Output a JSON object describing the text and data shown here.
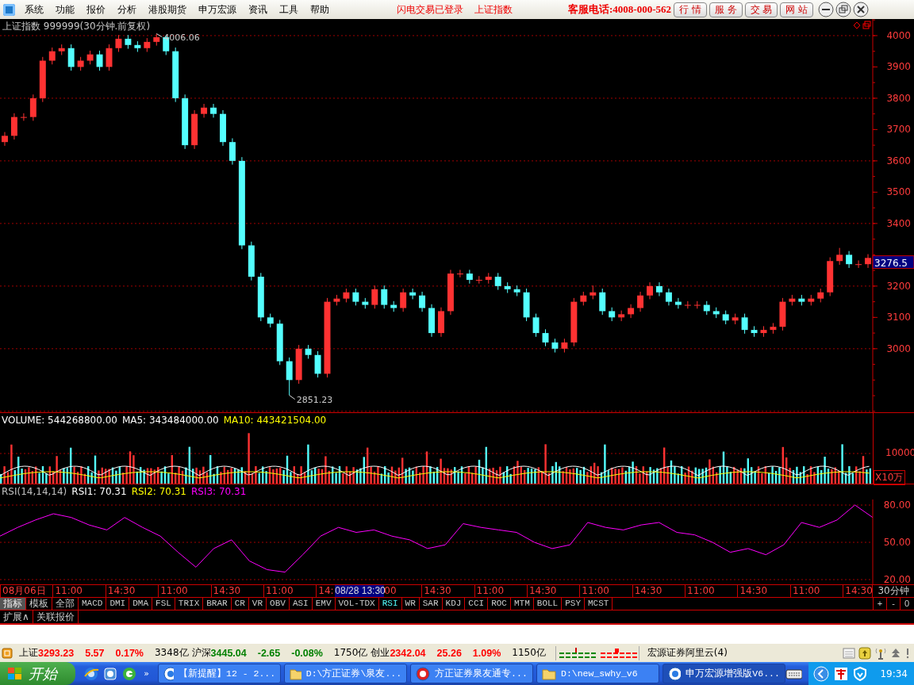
{
  "menu": {
    "items": [
      "系统",
      "功能",
      "报价",
      "分析",
      "港股期货",
      "申万宏源",
      "资讯",
      "工具",
      "帮助"
    ],
    "notices": [
      "闪电交易已登录",
      "上证指数"
    ],
    "hotline": "客服电话:4008-000-562",
    "buttons": [
      "行 情",
      "服 务",
      "交 易",
      "网 站"
    ]
  },
  "price_panel": {
    "chart_data": {
      "type": "candlestick",
      "title": "上证指数 999999(30分钟.前复权)",
      "ylim": [
        2797,
        4053
      ],
      "yticks": [
        3000,
        3100,
        3200,
        3400,
        3500,
        3600,
        3700,
        3800,
        3900,
        4000
      ],
      "grid": true,
      "ohlc": [
        [
          3660,
          3692,
          3648,
          3680
        ],
        [
          3680,
          3752,
          3668,
          3740
        ],
        [
          3740,
          3752,
          3728,
          3740
        ],
        [
          3740,
          3812,
          3728,
          3800
        ],
        [
          3800,
          3932,
          3788,
          3920
        ],
        [
          3920,
          3962,
          3908,
          3950
        ],
        [
          3950,
          3972,
          3938,
          3960
        ],
        [
          3960,
          3972,
          3888,
          3900
        ],
        [
          3900,
          3932,
          3888,
          3920
        ],
        [
          3920,
          3952,
          3908,
          3940
        ],
        [
          3940,
          3952,
          3888,
          3900
        ],
        [
          3900,
          3972,
          3888,
          3960
        ],
        [
          3960,
          4002,
          3948,
          3990
        ],
        [
          3990,
          4002,
          3958,
          3970
        ],
        [
          3970,
          3982,
          3948,
          3960
        ],
        [
          3960,
          3992,
          3948,
          3980
        ],
        [
          3980,
          4006.06,
          3968,
          3995
        ],
        [
          3995,
          4000,
          3938,
          3950
        ],
        [
          3950,
          3962,
          3788,
          3800
        ],
        [
          3800,
          3812,
          3638,
          3650
        ],
        [
          3650,
          3762,
          3638,
          3750
        ],
        [
          3750,
          3782,
          3738,
          3770
        ],
        [
          3770,
          3782,
          3738,
          3750
        ],
        [
          3750,
          3762,
          3648,
          3660
        ],
        [
          3660,
          3672,
          3588,
          3600
        ],
        [
          3600,
          3612,
          3318,
          3330
        ],
        [
          3330,
          3342,
          3218,
          3230
        ],
        [
          3230,
          3242,
          3088,
          3100
        ],
        [
          3100,
          3112,
          3068,
          3080
        ],
        [
          3080,
          3092,
          2948,
          2960
        ],
        [
          2960,
          2972,
          2851.23,
          2900
        ],
        [
          2900,
          3012,
          2888,
          3000
        ],
        [
          3000,
          3012,
          2968,
          2980
        ],
        [
          2980,
          2992,
          2908,
          2920
        ],
        [
          2920,
          3162,
          2908,
          3150
        ],
        [
          3150,
          3172,
          3138,
          3160
        ],
        [
          3160,
          3192,
          3148,
          3180
        ],
        [
          3180,
          3192,
          3138,
          3150
        ],
        [
          3150,
          3162,
          3128,
          3140
        ],
        [
          3140,
          3202,
          3128,
          3190
        ],
        [
          3190,
          3202,
          3128,
          3140
        ],
        [
          3140,
          3152,
          3118,
          3130
        ],
        [
          3130,
          3192,
          3118,
          3180
        ],
        [
          3180,
          3192,
          3158,
          3170
        ],
        [
          3170,
          3182,
          3118,
          3130
        ],
        [
          3130,
          3142,
          3038,
          3050
        ],
        [
          3050,
          3132,
          3038,
          3120
        ],
        [
          3120,
          3252,
          3108,
          3240
        ],
        [
          3240,
          3252,
          3228,
          3240
        ],
        [
          3240,
          3252,
          3208,
          3220
        ],
        [
          3220,
          3232,
          3208,
          3220
        ],
        [
          3220,
          3242,
          3208,
          3230
        ],
        [
          3230,
          3242,
          3188,
          3200
        ],
        [
          3200,
          3212,
          3178,
          3190
        ],
        [
          3190,
          3202,
          3168,
          3180
        ],
        [
          3180,
          3192,
          3088,
          3100
        ],
        [
          3100,
          3112,
          3038,
          3050
        ],
        [
          3050,
          3062,
          3008,
          3020
        ],
        [
          3020,
          3032,
          2988,
          3000
        ],
        [
          3000,
          3032,
          2988,
          3020
        ],
        [
          3020,
          3162,
          3008,
          3150
        ],
        [
          3150,
          3182,
          3138,
          3170
        ],
        [
          3170,
          3202,
          3158,
          3180
        ],
        [
          3180,
          3192,
          3108,
          3120
        ],
        [
          3120,
          3132,
          3088,
          3100
        ],
        [
          3100,
          3122,
          3088,
          3110
        ],
        [
          3110,
          3142,
          3098,
          3130
        ],
        [
          3130,
          3182,
          3118,
          3170
        ],
        [
          3170,
          3212,
          3158,
          3200
        ],
        [
          3200,
          3212,
          3168,
          3180
        ],
        [
          3180,
          3192,
          3138,
          3150
        ],
        [
          3150,
          3162,
          3128,
          3140
        ],
        [
          3140,
          3152,
          3128,
          3140
        ],
        [
          3140,
          3152,
          3128,
          3140
        ],
        [
          3140,
          3152,
          3108,
          3120
        ],
        [
          3120,
          3132,
          3098,
          3110
        ],
        [
          3110,
          3122,
          3078,
          3090
        ],
        [
          3090,
          3112,
          3078,
          3100
        ],
        [
          3100,
          3112,
          3048,
          3060
        ],
        [
          3060,
          3072,
          3038,
          3050
        ],
        [
          3050,
          3072,
          3038,
          3060
        ],
        [
          3060,
          3082,
          3048,
          3070
        ],
        [
          3070,
          3162,
          3058,
          3150
        ],
        [
          3150,
          3172,
          3138,
          3160
        ],
        [
          3160,
          3172,
          3138,
          3150
        ],
        [
          3150,
          3172,
          3138,
          3160
        ],
        [
          3160,
          3192,
          3148,
          3180
        ],
        [
          3180,
          3292,
          3168,
          3280
        ],
        [
          3280,
          3322,
          3268,
          3300
        ],
        [
          3300,
          3312,
          3258,
          3270
        ],
        [
          3270,
          3282,
          3258,
          3270
        ],
        [
          3270,
          3302,
          3258,
          3290
        ]
      ],
      "annotations": [
        "4006.06",
        "2851.23"
      ]
    },
    "price_marker": "3276.5"
  },
  "volume_panel": {
    "legend": [
      {
        "text": "VOLUME: 544268800.00",
        "color": "#ffffff"
      },
      {
        "text": "MA5: 343484000.00",
        "color": "#ffffff"
      },
      {
        "text": "MA10: 443421504.00",
        "color": "#ffff00"
      }
    ],
    "tick": "10000",
    "unit": "X10万"
  },
  "rsi_panel": {
    "legend": [
      {
        "text": "RSI(14,14,14)",
        "color": "#c0c0c0"
      },
      {
        "text": "RSI1: 70.31",
        "color": "#ffffff"
      },
      {
        "text": "RSI2: 70.31",
        "color": "#ffff00"
      },
      {
        "text": "RSI3: 70.31",
        "color": "#ff00ff"
      }
    ],
    "chart_data": {
      "type": "line",
      "ylim": [
        16.2,
        84.5
      ],
      "grid": true,
      "yticks": [
        {
          "value": 20,
          "label": "20.00"
        },
        {
          "value": 50,
          "label": "50.00"
        },
        {
          "value": 80,
          "label": "80.00"
        }
      ],
      "series": [
        {
          "color": "#ff00ff",
          "values": [
            55,
            62,
            68,
            73,
            70,
            64,
            60,
            70,
            62,
            55,
            42,
            30,
            45,
            52,
            35,
            28,
            26,
            40,
            55,
            62,
            58,
            60,
            55,
            52,
            45,
            48,
            65,
            62,
            60,
            58,
            50,
            45,
            48,
            66,
            62,
            60,
            64,
            66,
            58,
            56,
            50,
            42,
            45,
            40,
            48,
            66,
            62,
            68,
            80,
            70
          ]
        }
      ]
    }
  },
  "time_axis": {
    "labels": [
      {
        "text": "08月06日",
        "kind": "tick"
      },
      {
        "text": "11:00",
        "kind": "tick"
      },
      {
        "text": "14:30",
        "kind": "tick"
      },
      {
        "text": "11:00",
        "kind": "tick"
      },
      {
        "text": "14:30",
        "kind": "tick"
      },
      {
        "text": "11:00",
        "kind": "tick"
      },
      {
        "text": "14:",
        "kind": "tick"
      },
      {
        "text": "08/28 13:30",
        "kind": "cursor"
      },
      {
        "text": "00",
        "kind": "tick"
      },
      {
        "text": "14:30",
        "kind": "tick"
      },
      {
        "text": "11:00",
        "kind": "tick"
      },
      {
        "text": "14:30",
        "kind": "tick"
      },
      {
        "text": "11:00",
        "kind": "tick"
      },
      {
        "text": "14:30",
        "kind": "tick"
      },
      {
        "text": "11:00",
        "kind": "tick"
      },
      {
        "text": "14:30",
        "kind": "tick"
      },
      {
        "text": "11:00",
        "kind": "tick"
      },
      {
        "text": "14:30",
        "kind": "tick"
      }
    ],
    "period": "30分钟"
  },
  "indicator_tabs": [
    {
      "label": "指标",
      "selected": true
    },
    {
      "label": "模板",
      "selected": false
    },
    {
      "label": "全部",
      "selected": false
    },
    {
      "label": "MACD",
      "selected": false
    },
    {
      "label": "DMI",
      "selected": false
    },
    {
      "label": "DMA",
      "selected": false
    },
    {
      "label": "FSL",
      "selected": false
    },
    {
      "label": "TRIX",
      "selected": false
    },
    {
      "label": "BRAR",
      "selected": false
    },
    {
      "label": "CR",
      "selected": false
    },
    {
      "label": "VR",
      "selected": false
    },
    {
      "label": "OBV",
      "selected": false
    },
    {
      "label": "ASI",
      "selected": false
    },
    {
      "label": "EMV",
      "selected": false
    },
    {
      "label": "VOL-TDX",
      "selected": false
    },
    {
      "label": "RSI",
      "selected": true
    },
    {
      "label": "WR",
      "selected": false
    },
    {
      "label": "SAR",
      "selected": false
    },
    {
      "label": "KDJ",
      "selected": false
    },
    {
      "label": "CCI",
      "selected": false
    },
    {
      "label": "ROC",
      "selected": false
    },
    {
      "label": "MTM",
      "selected": false
    },
    {
      "label": "BOLL",
      "selected": false
    },
    {
      "label": "PSY",
      "selected": false
    },
    {
      "label": "MCST",
      "selected": false
    }
  ],
  "zoom_buttons": [
    "+",
    "-",
    "0"
  ],
  "extra_tabs": [
    "扩展∧",
    "关联报价"
  ],
  "status_bar": {
    "indices": [
      {
        "name": "上证",
        "value": "3293.23",
        "change": "5.57",
        "percent": "0.17%",
        "amount": "3348亿",
        "color": "#ff0000"
      },
      {
        "name": "沪深",
        "value": "3445.04",
        "change": "-2.65",
        "percent": "-0.08%",
        "amount": "1750亿",
        "color": "#008000"
      },
      {
        "name": "创业",
        "value": "2342.04",
        "change": "25.26",
        "percent": "1.09%",
        "amount": "1150亿",
        "color": "#ff0000"
      }
    ],
    "server": "宏源证券阿里云(4)"
  },
  "taskbar": {
    "start": "开始",
    "more": "»",
    "tasks": [
      {
        "label": "【新提醒】12 - 2...",
        "selected": false
      },
      {
        "label": "D:\\方正证券\\泉友...",
        "selected": false
      },
      {
        "label": "方正证券泉友通专...",
        "selected": false
      },
      {
        "label": "D:\\new_swhy_v6",
        "selected": false
      },
      {
        "label": "申万宏源增强版V6...",
        "selected": true
      }
    ],
    "clock": "19:34"
  }
}
